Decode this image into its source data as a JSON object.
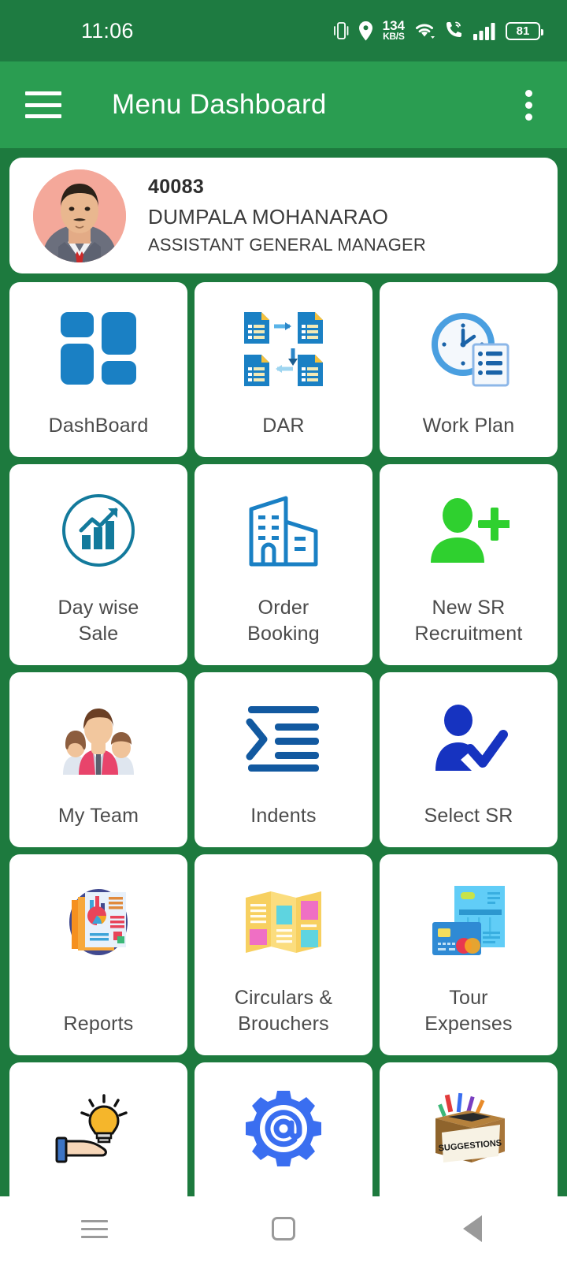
{
  "status_bar": {
    "time": "11:06",
    "network_speed_value": "134",
    "network_speed_unit": "KB/S",
    "battery_level": "81",
    "icons": [
      "vibrate-icon",
      "location-icon",
      "network-speed-icon",
      "wifi-icon",
      "vowifi-call-icon",
      "signal-bars-icon",
      "battery-icon"
    ],
    "background_color": "#1e7b41"
  },
  "app_bar": {
    "title": "Menu Dashboard",
    "menu_icon": "hamburger-menu-icon",
    "overflow_icon": "more-vertical-icon",
    "background_color": "#2a9d51"
  },
  "profile": {
    "employee_id": "40083",
    "name": "DUMPALA  MOHANARAO",
    "designation": "ASSISTANT GENERAL MANAGER",
    "avatar_icon": "user-photo-avatar"
  },
  "menu_grid": {
    "tiles": [
      {
        "label": "DashBoard",
        "icon": "dashboard-grid-icon"
      },
      {
        "label": "DAR",
        "icon": "documents-cycle-icon"
      },
      {
        "label": "Work Plan",
        "icon": "clock-checklist-icon"
      },
      {
        "label": "Day wise\nSale",
        "icon": "growth-chart-circle-icon"
      },
      {
        "label": "Order\nBooking",
        "icon": "office-building-icon"
      },
      {
        "label": "New SR\nRecruitment",
        "icon": "add-person-icon"
      },
      {
        "label": "My Team",
        "icon": "team-people-icon"
      },
      {
        "label": "Indents",
        "icon": "indent-list-icon"
      },
      {
        "label": "Select SR",
        "icon": "person-check-icon"
      },
      {
        "label": "Reports",
        "icon": "report-charts-icon"
      },
      {
        "label": "Circulars &\nBrouchers",
        "icon": "brochure-trifold-icon"
      },
      {
        "label": "Tour\nExpenses",
        "icon": "invoice-card-icon"
      },
      {
        "label": "",
        "icon": "hand-idea-bulb-icon"
      },
      {
        "label": "",
        "icon": "gear-at-sign-icon"
      },
      {
        "label": "",
        "icon": "suggestion-box-icon"
      }
    ]
  },
  "nav_bar": {
    "recent_label": "recent-apps-icon",
    "home_label": "home-icon",
    "back_label": "back-icon"
  },
  "colors": {
    "page_background": "#1d7a3e",
    "status_bar": "#1e7b41",
    "app_bar": "#2a9d51",
    "tile_background": "#ffffff",
    "tile_label": "#4b4b4b",
    "accent_blue": "#1a80c4",
    "accent_green": "#2fd02f",
    "accent_navy": "#1633c0"
  }
}
